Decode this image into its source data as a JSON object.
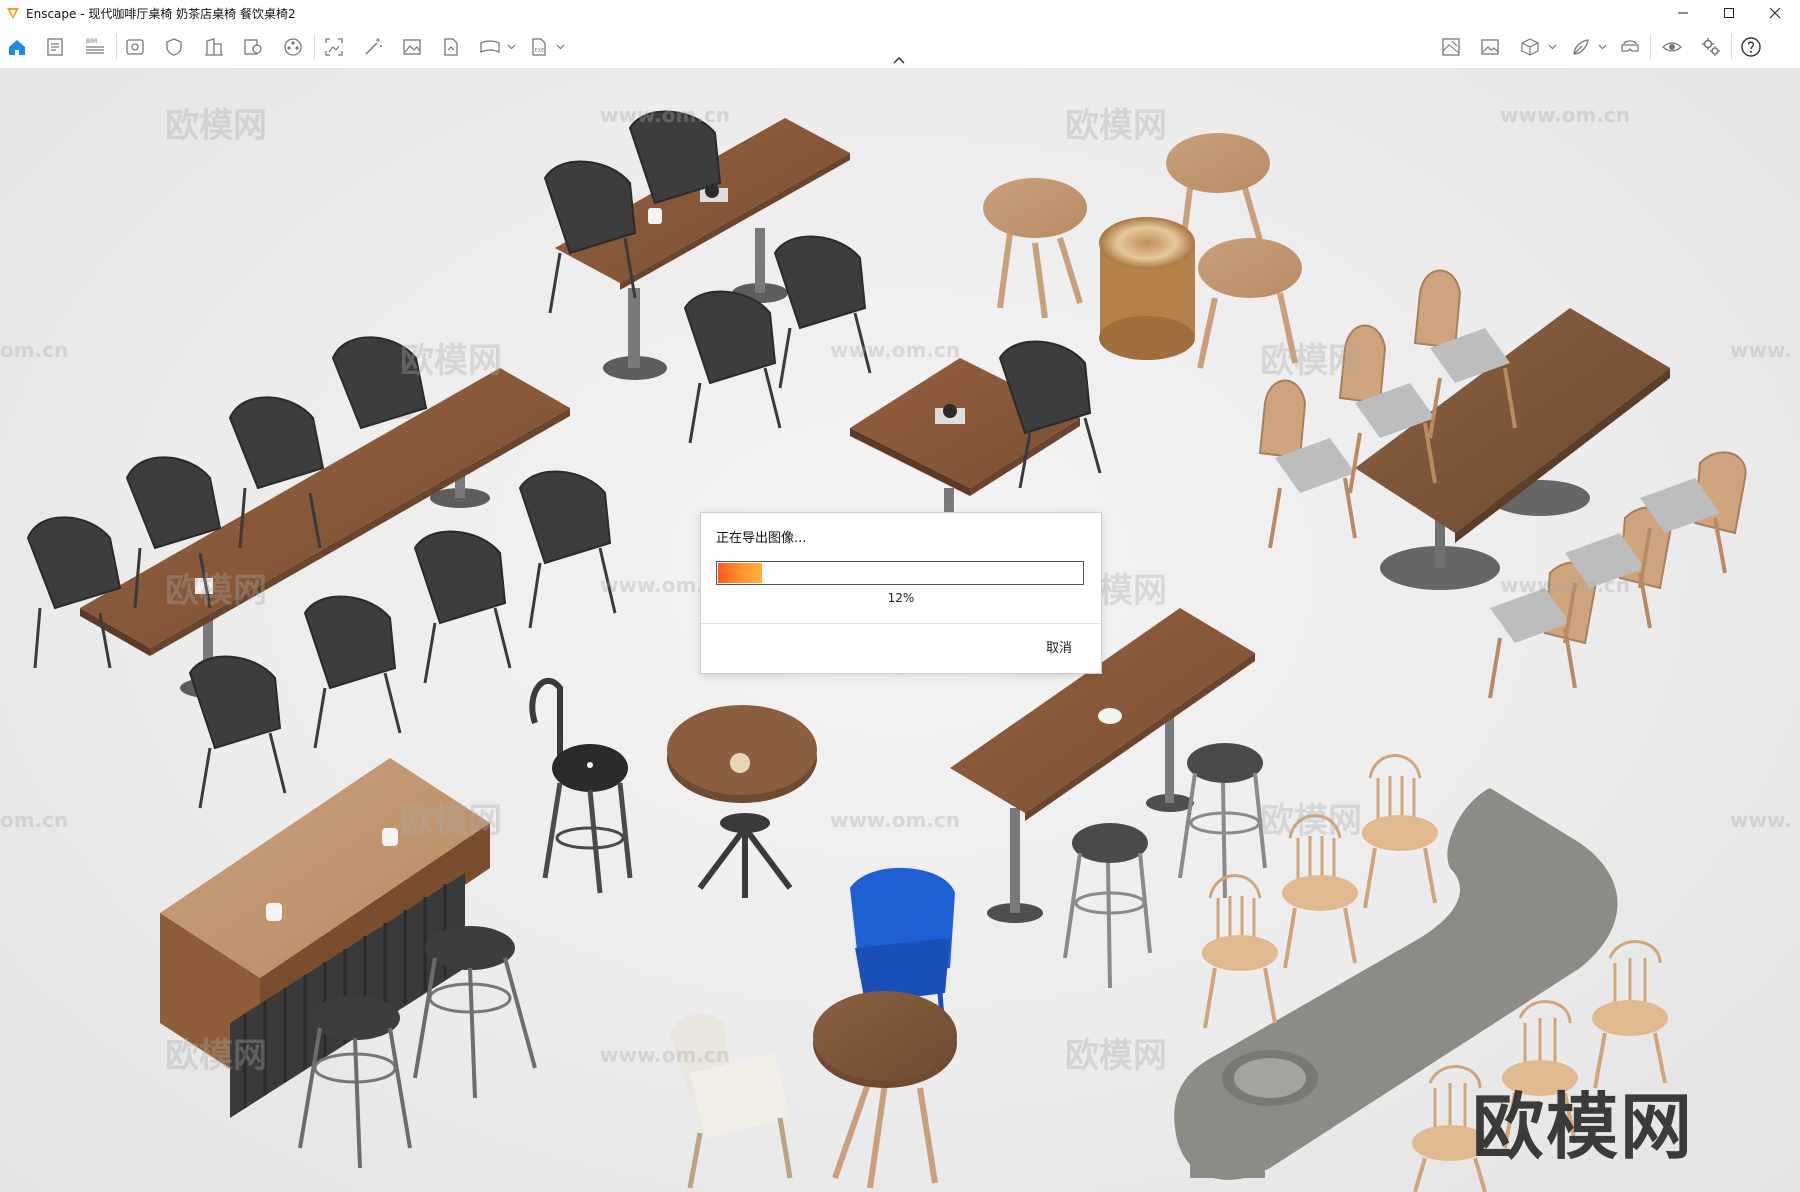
{
  "window": {
    "app_name": "Enscape",
    "title": "Enscape - 现代咖啡厅桌椅 奶茶店桌椅 餐饮桌椅2",
    "controls": [
      "minimize-icon",
      "maximize-icon",
      "close-icon"
    ]
  },
  "toolbar": {
    "left_icons": [
      "home-icon",
      "document-icon",
      "bim-icon",
      "visual-settings-icon",
      "shield-icon",
      "building-icon",
      "asset-library-icon",
      "film-reel-icon",
      "export-view-icon",
      "magic-wand-icon",
      "image-icon",
      "file-export-icon",
      "panorama-icon",
      "exe-export-icon"
    ],
    "bim_label": "BIM",
    "exe_label": "EXE",
    "right_icons": [
      "minimap-icon",
      "gallery-icon",
      "cube-view-icon",
      "paint-icon",
      "vr-headset-icon",
      "eye-icon",
      "settings-icon",
      "help-icon"
    ]
  },
  "dialog": {
    "title": "正在导出图像...",
    "progress": 0.12,
    "progress_text": "12%",
    "cancel_label": "取消"
  },
  "watermark": {
    "brand": "欧模网",
    "url": "www.om.cn",
    "url_fragment": "om.cn",
    "url_fragment_right": "www."
  },
  "colors": {
    "accent": "#1e88e5",
    "progress_start": "#ff5a1f",
    "progress_end": "#ffb03a",
    "dark_wood": "#8a5a3b",
    "light_wood": "#c49a6c",
    "chair_dark": "#3a3a3a",
    "chair_blue": "#1f5fd4",
    "stone": "#8d8b86"
  }
}
